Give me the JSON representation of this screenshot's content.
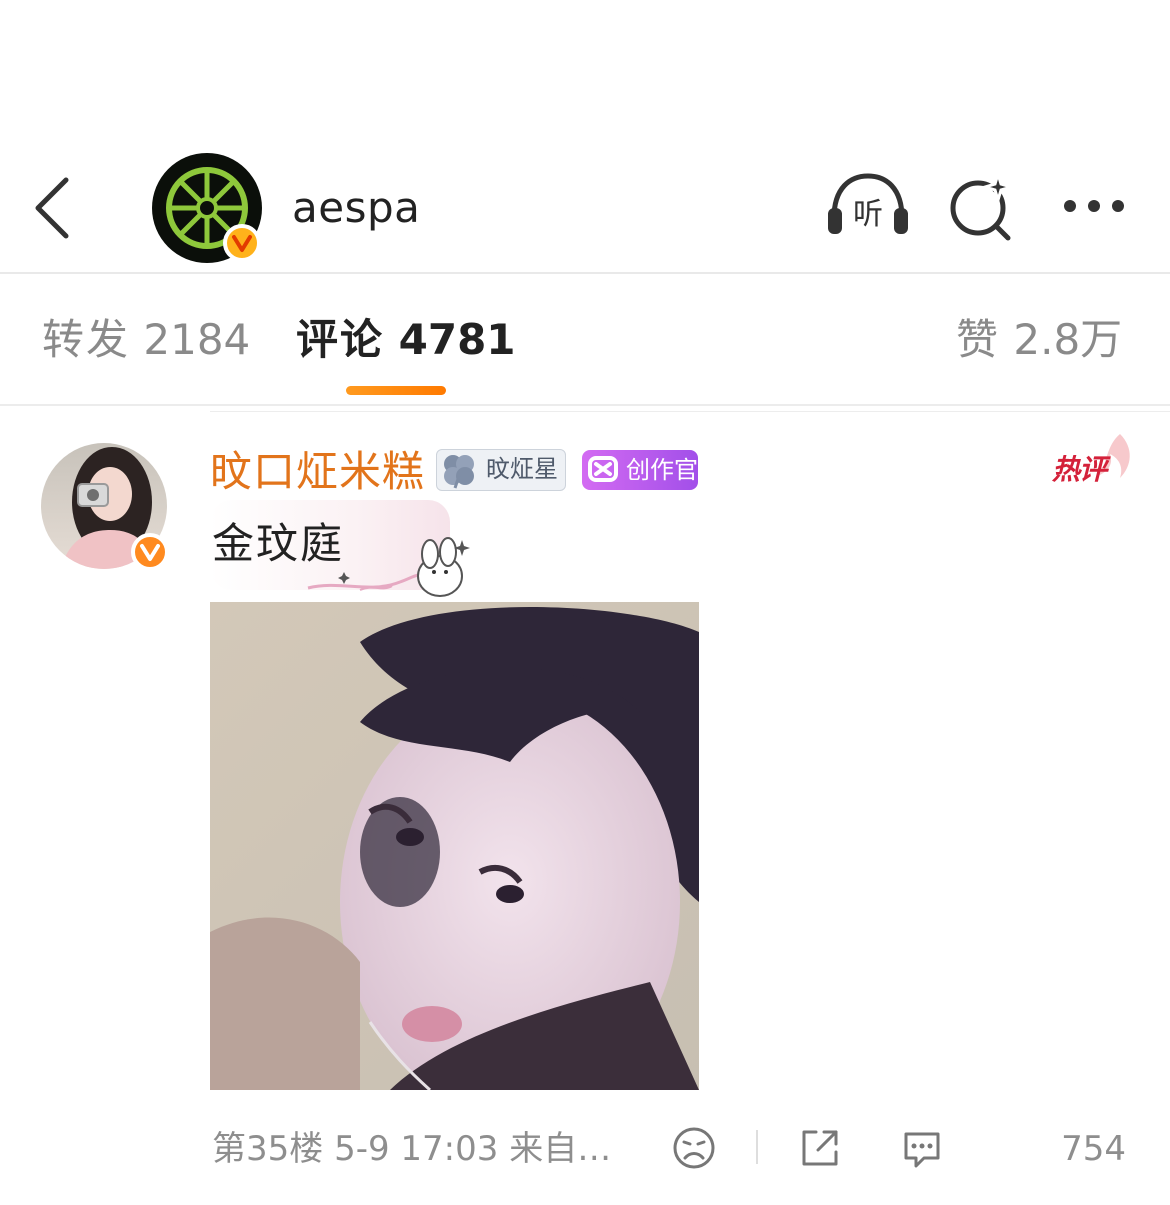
{
  "header": {
    "title": "aespa",
    "listen_label": "听",
    "icons": [
      "back-chevron-icon",
      "verified-badge-icon",
      "headphones-icon",
      "search-sparkle-icon",
      "more-dots-icon"
    ]
  },
  "tabs": [
    {
      "label": "转发",
      "count": "2184"
    },
    {
      "label": "评论",
      "count": "4781",
      "active": true
    },
    {
      "label": "赞",
      "count": "2.8万"
    }
  ],
  "comment": {
    "user_name": "旼口炡米糕",
    "badges": [
      "旼炡星",
      "创作官"
    ],
    "hot_label": "热评",
    "text": "金玟庭",
    "floor_time_source": "第35楼 5-9 17:03 来自…",
    "like_count": "754"
  },
  "colors": {
    "accent": "#ff8200",
    "username": "#e2741b",
    "hot": "#d4213a",
    "creator_badge": "#b45cf0"
  }
}
